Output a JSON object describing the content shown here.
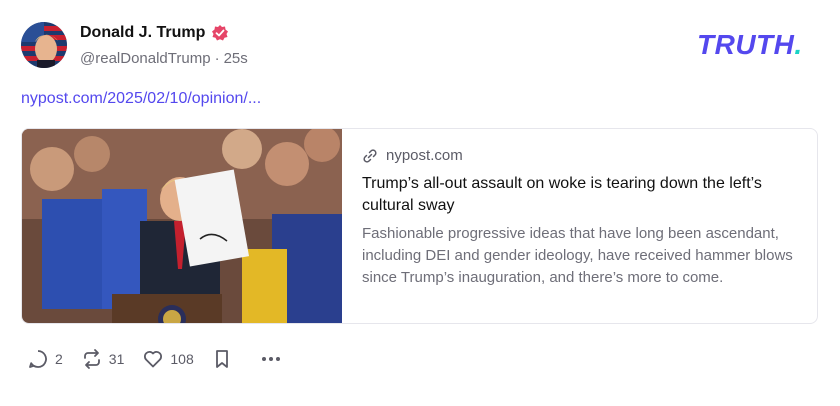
{
  "post": {
    "author_name": "Donald J. Trump",
    "handle": "@realDonaldTrump",
    "separator": "·",
    "time_ago": "25s",
    "link_text": "nypost.com/2025/02/10/opinion/..."
  },
  "brand": {
    "logo_text": "TRUTH",
    "logo_dot": ".",
    "colors": {
      "primary": "#5448ee",
      "accent": "#19d3c5",
      "verified": "#e64568"
    }
  },
  "card": {
    "domain": "nypost.com",
    "title": "Trump’s all-out assault on woke is tearing down the left’s cultural sway",
    "description": "Fashionable progressive ideas that have long been ascendant, including DEI and gender ideology, have received hammer blows since Trump’s inauguration, and there’s more to come."
  },
  "actions": {
    "replies": "2",
    "retruths": "31",
    "likes": "108"
  },
  "icons": [
    "verified-badge-icon",
    "link-icon",
    "reply-icon",
    "retruth-icon",
    "heart-icon",
    "bookmark-icon",
    "more-icon"
  ]
}
